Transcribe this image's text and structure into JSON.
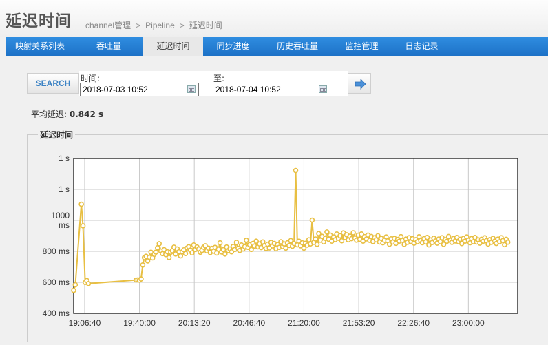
{
  "header": {
    "title": "延迟时间",
    "breadcrumb": [
      "channel管理",
      "Pipeline",
      "延迟时间"
    ],
    "separator": ">"
  },
  "tabs": [
    {
      "label": "映射关系列表",
      "active": false
    },
    {
      "label": "吞吐量",
      "active": false
    },
    {
      "label": "延迟时间",
      "active": true
    },
    {
      "label": "同步进度",
      "active": false
    },
    {
      "label": "历史吞吐量",
      "active": false
    },
    {
      "label": "监控管理",
      "active": false
    },
    {
      "label": "日志记录",
      "active": false
    }
  ],
  "search": {
    "button_label": "SEARCH",
    "start_label": "时间:",
    "start_value": "2018-07-03 10:52",
    "end_label": "至:",
    "end_value": "2018-07-04 10:52"
  },
  "stats": {
    "avg_label": "平均延迟:",
    "avg_value": "0.842 s"
  },
  "chart_panel": {
    "legend": "延迟时间"
  },
  "colors": {
    "nav": "#2281d6",
    "series": "#e8bf42",
    "accent": "#3d83c4"
  },
  "chart_data": {
    "type": "line",
    "title": "",
    "xlabel": "",
    "ylabel": "",
    "grid": true,
    "ylim": [
      400,
      1000
    ],
    "xlim": [
      "19:00:00",
      "23:30:00"
    ],
    "x_ticks": [
      "19:06:40",
      "19:40:00",
      "20:13:20",
      "20:46:40",
      "21:20:00",
      "21:53:20",
      "22:26:40",
      "23:00:00"
    ],
    "y_ticks": [
      {
        "value": 400,
        "label": "400 ms"
      },
      {
        "value": 600,
        "label": "600 ms"
      },
      {
        "value": 800,
        "label": "800 ms"
      },
      {
        "value": 1000,
        "label": "1000\nms"
      },
      {
        "value": 1200,
        "label": "1 s"
      },
      {
        "value": 1400,
        "label": "1 s"
      }
    ],
    "y_range": [
      400,
      1400
    ],
    "series": [
      {
        "name": "",
        "points": [
          [
            "19:00:00",
            548
          ],
          [
            "19:01:00",
            584
          ],
          [
            "19:04:40",
            1104
          ],
          [
            "19:05:40",
            965
          ],
          [
            "19:07:00",
            599
          ],
          [
            "19:08:00",
            612
          ],
          [
            "19:09:00",
            592
          ],
          [
            "19:38:00",
            615
          ],
          [
            "19:39:00",
            616
          ],
          [
            "19:40:00",
            614
          ],
          [
            "19:41:00",
            622
          ],
          [
            "19:42:00",
            712
          ],
          [
            "19:43:00",
            760
          ],
          [
            "19:44:00",
            768
          ],
          [
            "19:45:00",
            738
          ],
          [
            "19:46:00",
            762
          ],
          [
            "19:47:00",
            794
          ],
          [
            "19:48:00",
            758
          ],
          [
            "19:49:00",
            781
          ],
          [
            "19:50:00",
            795
          ],
          [
            "19:51:00",
            823
          ],
          [
            "19:52:00",
            849
          ],
          [
            "19:53:00",
            802
          ],
          [
            "19:54:00",
            785
          ],
          [
            "19:55:00",
            811
          ],
          [
            "19:56:00",
            779
          ],
          [
            "19:57:00",
            797
          ],
          [
            "19:58:00",
            760
          ],
          [
            "19:59:00",
            794
          ],
          [
            "20:00:00",
            804
          ],
          [
            "20:01:00",
            827
          ],
          [
            "20:02:00",
            783
          ],
          [
            "20:03:00",
            816
          ],
          [
            "20:04:00",
            797
          ],
          [
            "20:05:00",
            771
          ],
          [
            "20:06:00",
            796
          ],
          [
            "20:07:00",
            810
          ],
          [
            "20:08:00",
            786
          ],
          [
            "20:09:00",
            822
          ],
          [
            "20:10:00",
            830
          ],
          [
            "20:11:00",
            808
          ],
          [
            "20:12:00",
            790
          ],
          [
            "20:13:00",
            841
          ],
          [
            "20:14:00",
            812
          ],
          [
            "20:15:00",
            828
          ],
          [
            "20:16:00",
            815
          ],
          [
            "20:17:00",
            794
          ],
          [
            "20:18:00",
            806
          ],
          [
            "20:19:00",
            827
          ],
          [
            "20:20:00",
            836
          ],
          [
            "20:21:00",
            803
          ],
          [
            "20:22:00",
            821
          ],
          [
            "20:23:00",
            792
          ],
          [
            "20:24:00",
            819
          ],
          [
            "20:25:00",
            801
          ],
          [
            "20:26:00",
            826
          ],
          [
            "20:27:00",
            789
          ],
          [
            "20:28:00",
            814
          ],
          [
            "20:29:00",
            855
          ],
          [
            "20:30:00",
            796
          ],
          [
            "20:31:00",
            811
          ],
          [
            "20:32:00",
            783
          ],
          [
            "20:33:00",
            828
          ],
          [
            "20:34:00",
            805
          ],
          [
            "20:35:00",
            816
          ],
          [
            "20:36:00",
            797
          ],
          [
            "20:37:00",
            832
          ],
          [
            "20:38:00",
            812
          ],
          [
            "20:39:00",
            858
          ],
          [
            "20:40:00",
            820
          ],
          [
            "20:41:00",
            806
          ],
          [
            "20:42:00",
            841
          ],
          [
            "20:43:00",
            815
          ],
          [
            "20:44:00",
            830
          ],
          [
            "20:45:00",
            872
          ],
          [
            "20:46:00",
            826
          ],
          [
            "20:47:00",
            843
          ],
          [
            "20:48:00",
            812
          ],
          [
            "20:49:00",
            851
          ],
          [
            "20:50:00",
            834
          ],
          [
            "20:51:00",
            866
          ],
          [
            "20:52:00",
            829
          ],
          [
            "20:53:00",
            848
          ],
          [
            "20:54:00",
            824
          ],
          [
            "20:55:00",
            861
          ],
          [
            "20:56:00",
            837
          ],
          [
            "20:57:00",
            818
          ],
          [
            "20:58:00",
            846
          ],
          [
            "20:59:00",
            822
          ],
          [
            "21:00:00",
            858
          ],
          [
            "21:01:00",
            835
          ],
          [
            "21:02:00",
            851
          ],
          [
            "21:03:00",
            817
          ],
          [
            "21:04:00",
            844
          ],
          [
            "21:05:00",
            826
          ],
          [
            "21:06:00",
            862
          ],
          [
            "21:07:00",
            831
          ],
          [
            "21:08:00",
            848
          ],
          [
            "21:09:00",
            821
          ],
          [
            "21:10:00",
            855
          ],
          [
            "21:11:00",
            838
          ],
          [
            "21:12:00",
            870
          ],
          [
            "21:13:00",
            833
          ],
          [
            "21:14:00",
            851
          ],
          [
            "21:15:00",
            1322
          ],
          [
            "21:16:00",
            842
          ],
          [
            "21:17:00",
            866
          ],
          [
            "21:18:00",
            836
          ],
          [
            "21:19:00",
            855
          ],
          [
            "21:20:00",
            821
          ],
          [
            "21:21:00",
            852
          ],
          [
            "21:22:00",
            840
          ],
          [
            "21:23:00",
            875
          ],
          [
            "21:24:00",
            848
          ],
          [
            "21:25:00",
            1002
          ],
          [
            "21:26:00",
            858
          ],
          [
            "21:27:00",
            880
          ],
          [
            "21:28:00",
            845
          ],
          [
            "21:29:00",
            915
          ],
          [
            "21:30:00",
            872
          ],
          [
            "21:31:00",
            897
          ],
          [
            "21:32:00",
            861
          ],
          [
            "21:33:00",
            884
          ],
          [
            "21:34:00",
            925
          ],
          [
            "21:35:00",
            878
          ],
          [
            "21:36:00",
            905
          ],
          [
            "21:37:00",
            866
          ],
          [
            "21:38:00",
            893
          ],
          [
            "21:39:00",
            875
          ],
          [
            "21:40:00",
            912
          ],
          [
            "21:41:00",
            884
          ],
          [
            "21:42:00",
            901
          ],
          [
            "21:43:00",
            868
          ],
          [
            "21:44:00",
            919
          ],
          [
            "21:45:00",
            889
          ],
          [
            "21:46:00",
            907
          ],
          [
            "21:47:00",
            874
          ],
          [
            "21:48:00",
            898
          ],
          [
            "21:49:00",
            882
          ],
          [
            "21:50:00",
            920
          ],
          [
            "21:51:00",
            886
          ],
          [
            "21:52:00",
            872
          ],
          [
            "21:53:00",
            904
          ],
          [
            "21:54:00",
            878
          ],
          [
            "21:55:00",
            912
          ],
          [
            "21:56:00",
            866
          ],
          [
            "21:57:00",
            895
          ],
          [
            "21:58:00",
            880
          ],
          [
            "21:59:00",
            905
          ],
          [
            "22:00:00",
            871
          ],
          [
            "22:01:00",
            896
          ],
          [
            "22:02:00",
            863
          ],
          [
            "22:03:00",
            888
          ],
          [
            "22:04:00",
            874
          ],
          [
            "22:05:00",
            901
          ],
          [
            "22:06:00",
            860
          ],
          [
            "22:07:00",
            884
          ],
          [
            "22:08:00",
            855
          ],
          [
            "22:09:00",
            872
          ],
          [
            "22:10:00",
            893
          ],
          [
            "22:11:00",
            868
          ],
          [
            "22:12:00",
            846
          ],
          [
            "22:13:00",
            881
          ],
          [
            "22:14:00",
            860
          ],
          [
            "22:15:00",
            884
          ],
          [
            "22:16:00",
            852
          ],
          [
            "22:17:00",
            877
          ],
          [
            "22:18:00",
            866
          ],
          [
            "22:19:00",
            895
          ],
          [
            "22:20:00",
            871
          ],
          [
            "22:21:00",
            845
          ],
          [
            "22:22:00",
            879
          ],
          [
            "22:23:00",
            858
          ],
          [
            "22:24:00",
            888
          ],
          [
            "22:25:00",
            864
          ],
          [
            "22:26:00",
            882
          ],
          [
            "22:27:00",
            853
          ],
          [
            "22:28:00",
            876
          ],
          [
            "22:29:00",
            862
          ],
          [
            "22:30:00",
            894
          ],
          [
            "22:31:00",
            870
          ],
          [
            "22:32:00",
            856
          ],
          [
            "22:33:00",
            882
          ],
          [
            "22:34:00",
            861
          ],
          [
            "22:35:00",
            890
          ],
          [
            "22:36:00",
            842
          ],
          [
            "22:37:00",
            874
          ],
          [
            "22:38:00",
            857
          ],
          [
            "22:39:00",
            885
          ],
          [
            "22:40:00",
            867
          ],
          [
            "22:41:00",
            853
          ],
          [
            "22:42:00",
            880
          ],
          [
            "22:43:00",
            862
          ],
          [
            "22:44:00",
            888
          ],
          [
            "22:45:00",
            845
          ],
          [
            "22:46:00",
            876
          ],
          [
            "22:47:00",
            865
          ],
          [
            "22:48:00",
            896
          ],
          [
            "22:49:00",
            872
          ],
          [
            "22:50:00",
            858
          ],
          [
            "22:51:00",
            883
          ],
          [
            "22:52:00",
            867
          ],
          [
            "22:53:00",
            890
          ],
          [
            "22:54:00",
            862
          ],
          [
            "22:55:00",
            878
          ],
          [
            "22:56:00",
            850
          ],
          [
            "22:57:00",
            884
          ],
          [
            "22:58:00",
            866
          ],
          [
            "22:59:00",
            893
          ],
          [
            "23:00:00",
            872
          ],
          [
            "23:01:00",
            855
          ],
          [
            "23:02:00",
            883
          ],
          [
            "23:03:00",
            862
          ],
          [
            "23:04:00",
            890
          ],
          [
            "23:05:00",
            860
          ],
          [
            "23:06:00",
            875
          ],
          [
            "23:07:00",
            853
          ],
          [
            "23:08:00",
            878
          ],
          [
            "23:09:00",
            865
          ],
          [
            "23:10:00",
            888
          ],
          [
            "23:11:00",
            869
          ],
          [
            "23:12:00",
            847
          ],
          [
            "23:13:00",
            876
          ],
          [
            "23:14:00",
            858
          ],
          [
            "23:15:00",
            884
          ],
          [
            "23:16:00",
            866
          ],
          [
            "23:17:00",
            851
          ],
          [
            "23:18:00",
            879
          ],
          [
            "23:19:00",
            862
          ],
          [
            "23:20:00",
            888
          ],
          [
            "23:21:00",
            870
          ],
          [
            "23:22:00",
            843
          ],
          [
            "23:23:00",
            878
          ],
          [
            "23:24:00",
            859
          ]
        ]
      }
    ]
  }
}
